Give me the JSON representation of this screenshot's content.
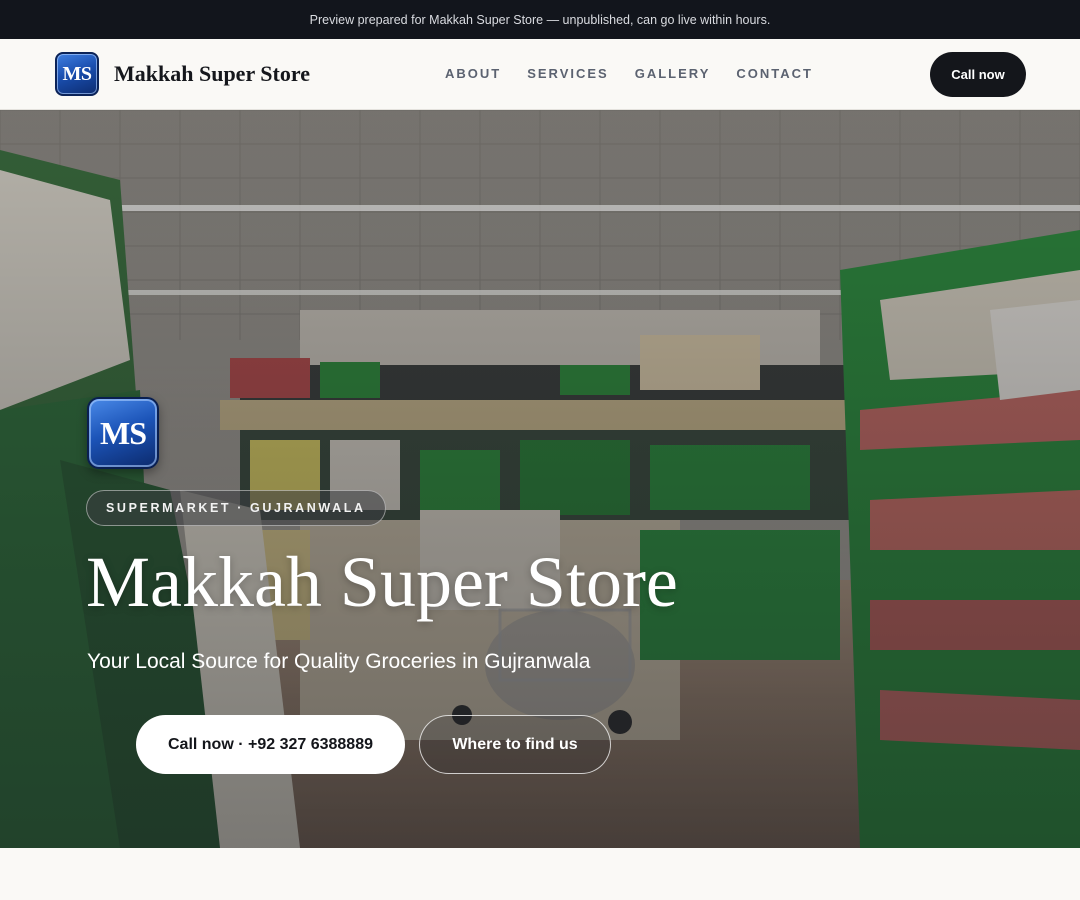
{
  "preview_bar": {
    "text": "Preview prepared for Makkah Super Store — unpublished, can go live within hours."
  },
  "header": {
    "logo_text": "MS",
    "brand_name": "Makkah Super Store",
    "nav": [
      {
        "label": "ABOUT"
      },
      {
        "label": "SERVICES"
      },
      {
        "label": "GALLERY"
      },
      {
        "label": "CONTACT"
      }
    ],
    "cta_label": "Call now"
  },
  "hero": {
    "logo_text": "MS",
    "badge": "SUPERMARKET · GUJRANWALA",
    "title": "Makkah Super Store",
    "subtitle": "Your Local Source for Quality Groceries in Gujranwala",
    "primary_button": "Call now · +92 327 6388889",
    "secondary_button": "Where to find us",
    "background_image": "supermarket-aisle-photo"
  },
  "colors": {
    "dark": "#14161b",
    "logo_blue": "#1a4fb0",
    "page_bg": "#faf9f6"
  }
}
